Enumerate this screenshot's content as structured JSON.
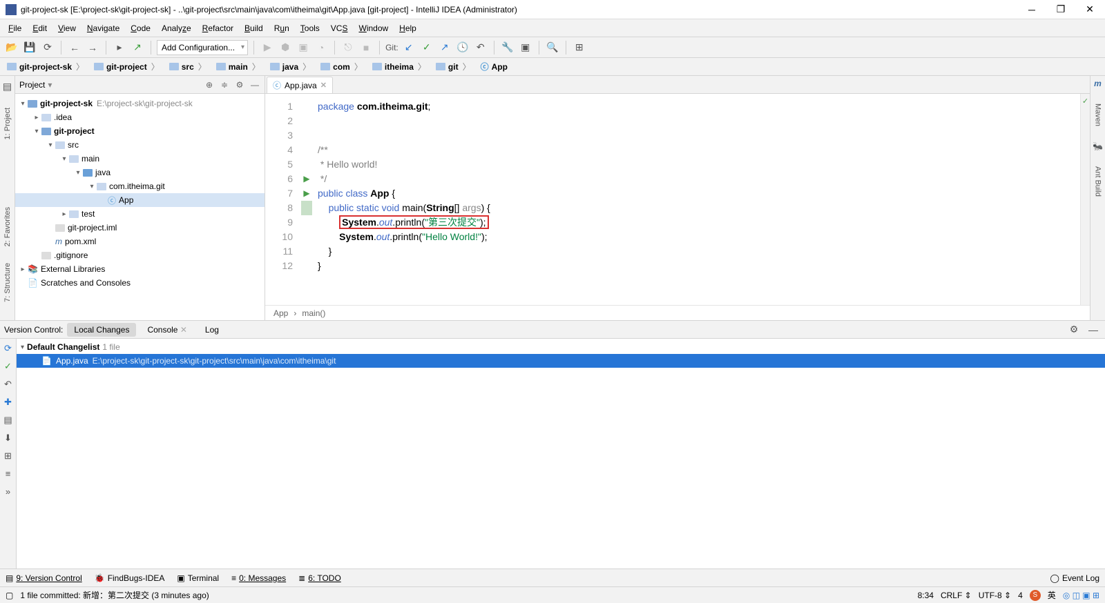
{
  "title": "git-project-sk [E:\\project-sk\\git-project-sk] - ..\\git-project\\src\\main\\java\\com\\itheima\\git\\App.java [git-project] - IntelliJ IDEA (Administrator)",
  "menu": [
    "File",
    "Edit",
    "View",
    "Navigate",
    "Code",
    "Analyze",
    "Refactor",
    "Build",
    "Run",
    "Tools",
    "VCS",
    "Window",
    "Help"
  ],
  "toolbar": {
    "config": "Add Configuration...",
    "git_label": "Git:"
  },
  "breadcrumbs": [
    "git-project-sk",
    "git-project",
    "src",
    "main",
    "java",
    "com",
    "itheima",
    "git",
    "App"
  ],
  "project_panel": {
    "title": "Project",
    "root": {
      "name": "git-project-sk",
      "path": "E:\\project-sk\\git-project-sk"
    },
    "idea": ".idea",
    "module": "git-project",
    "src": "src",
    "main": "main",
    "java": "java",
    "pkg": "com.itheima.git",
    "app": "App",
    "test": "test",
    "iml": "git-project.iml",
    "pom": "pom.xml",
    "gitignore": ".gitignore",
    "ext": "External Libraries",
    "scratch": "Scratches and Consoles"
  },
  "left_tabs": {
    "project": "1: Project",
    "favorites": "2: Favorites",
    "structure": "7: Structure"
  },
  "right_tabs": {
    "maven": "Maven",
    "ant": "Ant Build"
  },
  "editor": {
    "tab": "App.java",
    "lines": [
      "1",
      "2",
      "3",
      "4",
      "5",
      "6",
      "7",
      "8",
      "9",
      "10",
      "11",
      "12"
    ],
    "code": {
      "pkg_kw": "package ",
      "pkg": "com.itheima.git",
      "semi": ";",
      "c1": "/**",
      "c2": " * Hello world!",
      "c3": " */",
      "pub": "public ",
      "cls_kw": "class ",
      "cls": "App",
      "brace": " {",
      "m_pub": "public ",
      "m_static": "static ",
      "m_void": "void ",
      "m_name": "main",
      "m_args": "(",
      "m_type": "String",
      "m_arr": "[] ",
      "m_argn": "args",
      "m_close": ") {",
      "sys": "System",
      "dot": ".",
      "out": "out",
      "println": "println",
      "paren": "(",
      "str1": "\"第三次提交\"",
      "end1": ");",
      "str2": "\"Hello World!\"",
      "end2": ");",
      "cb1": "}",
      "cb2": "}"
    },
    "crumbs": {
      "a": "App",
      "b": "main()"
    }
  },
  "vcpanel": {
    "title": "Version Control:",
    "tabs": [
      "Local Changes",
      "Console",
      "Log"
    ],
    "changelist": "Default Changelist",
    "count": "1 file",
    "file": "App.java",
    "path": "E:\\project-sk\\git-project-sk\\git-project\\src\\main\\java\\com\\itheima\\git"
  },
  "bottom_bar": {
    "items": [
      "9: Version Control",
      "FindBugs-IDEA",
      "Terminal",
      "0: Messages",
      "6: TODO"
    ],
    "event": "Event Log"
  },
  "status": {
    "msg": "1 file committed: 新增：第二次提交 (3 minutes ago)",
    "pos": "8:34",
    "crlf": "CRLF",
    "enc": "UTF-8",
    "indent": "4"
  }
}
